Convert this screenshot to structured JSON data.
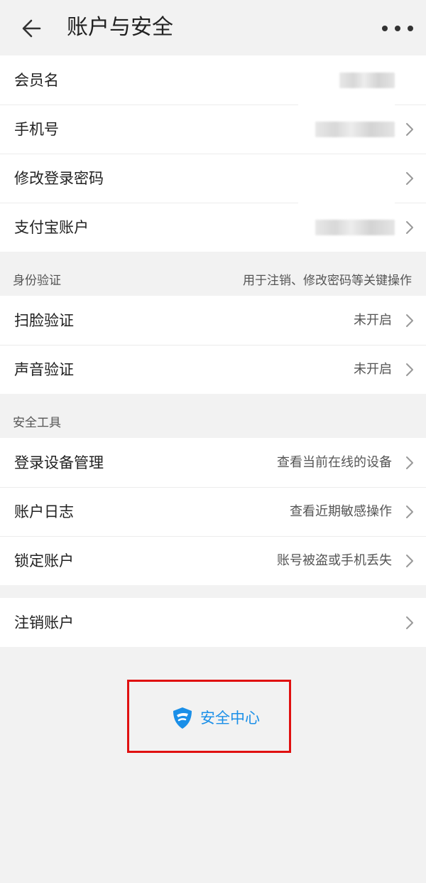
{
  "header": {
    "title": "账户与安全"
  },
  "account": {
    "items": [
      {
        "label": "会员名",
        "value": ""
      },
      {
        "label": "手机号",
        "value": ""
      },
      {
        "label": "修改登录密码",
        "value": ""
      },
      {
        "label": "支付宝账户",
        "value": ""
      }
    ]
  },
  "identity": {
    "header_left": "身份验证",
    "header_right": "用于注销、修改密码等关键操作",
    "items": [
      {
        "label": "扫脸验证",
        "value": "未开启"
      },
      {
        "label": "声音验证",
        "value": "未开启"
      }
    ]
  },
  "tools": {
    "header_left": "安全工具",
    "items": [
      {
        "label": "登录设备管理",
        "value": "查看当前在线的设备"
      },
      {
        "label": "账户日志",
        "value": "查看近期敏感操作"
      },
      {
        "label": "锁定账户",
        "value": "账号被盗或手机丢失"
      }
    ]
  },
  "cancel": {
    "label": "注销账户"
  },
  "security_center": {
    "label": "安全中心",
    "accent_color": "#1a8fe8",
    "highlight_color": "#e01010"
  },
  "icons": {
    "back": "back-arrow-icon",
    "more": "more-dots-icon",
    "chevron": "chevron-right-icon",
    "shield": "shield-icon"
  }
}
